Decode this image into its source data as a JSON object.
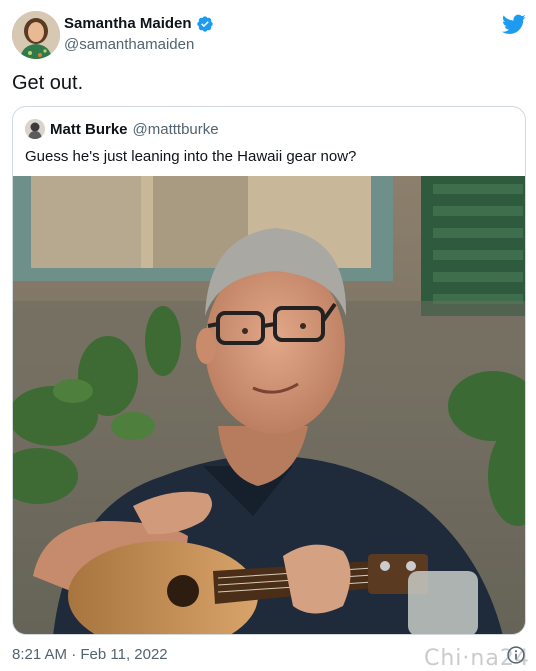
{
  "author": {
    "display_name": "Samantha Maiden",
    "handle": "@samanthamaiden",
    "verified": true
  },
  "tweet": {
    "text": "Get out."
  },
  "quoted_tweet": {
    "display_name": "Matt Burke",
    "handle": "@matttburke",
    "text": "Guess he's just leaning into the Hawaii gear now?"
  },
  "meta": {
    "timestamp": "8:21 AM · Feb 11, 2022"
  },
  "watermark": {
    "text": "Chi·na24"
  },
  "icons": {
    "verified": "verified-badge-icon",
    "brand": "twitter-bird-icon",
    "info": "info-icon"
  },
  "colors": {
    "brand": "#1d9bf0",
    "text": "#0f1419",
    "secondary": "#536471",
    "border": "#cfd9de"
  }
}
